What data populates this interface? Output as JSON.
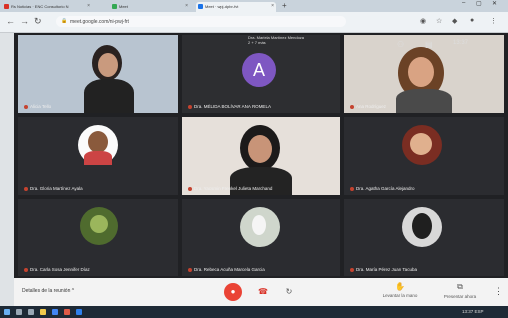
{
  "browser": {
    "tabs": [
      {
        "label": "Rs Noticias · ENC Consultorio N",
        "favicon_color": "#d93025"
      },
      {
        "label": "Meet",
        "favicon_color": "#34a853"
      },
      {
        "label": "Meet · wpj-dpbr-fvt",
        "favicon_color": "#1a73e8"
      }
    ],
    "new_tab": "+",
    "window_controls": [
      "–",
      "▢",
      "✕"
    ],
    "url": "meet.google.com/ni-pwj-frt"
  },
  "meeting": {
    "top_info": [
      "Dra. Mariela Martínez Mendoza",
      "2 + 7 más"
    ],
    "clock": "13:37",
    "participants": [
      {
        "name": "Alicia Tello"
      },
      {
        "name": "Dra. MÉLIDA BOLÍVAR ANA ROMELA",
        "avatar_letter": "A",
        "avatar_color": "#7e57c2"
      },
      {
        "name": "Ana Rodríguez"
      },
      {
        "name": "Dra. Gloria Martínez Ayala"
      },
      {
        "name": "Dra. Yacsmin Frenkel Julieta Marchand"
      },
      {
        "name": "Dra. Agatha García Alejandro"
      },
      {
        "name": "Dra. Carla Sosa Jennifer Díaz"
      },
      {
        "name": "Dra. Rebeca Acuña Marcela Garcia"
      },
      {
        "name": "Dra. María Pérez Juan Tacuba"
      }
    ]
  },
  "controls": {
    "details": "Detalles de la reunión",
    "mic_icon": "●",
    "hang_icon": "☎",
    "cam_icon": "↻",
    "present1": "Levantar la mano",
    "present2": "Presentar ahora",
    "more": "⋮"
  },
  "taskbar": {
    "tray": "13:37  ESP"
  }
}
